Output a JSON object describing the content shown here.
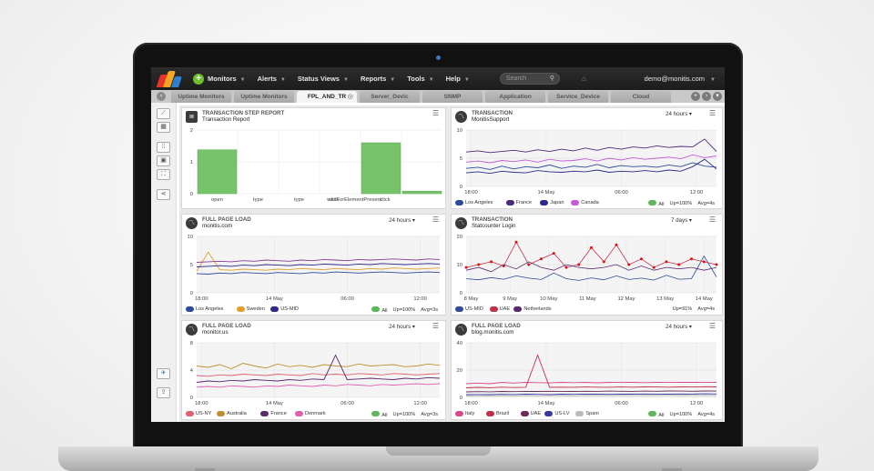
{
  "nav": {
    "menus": [
      {
        "label": "Monitors"
      },
      {
        "label": "Alerts"
      },
      {
        "label": "Status Views"
      },
      {
        "label": "Reports"
      },
      {
        "label": "Tools"
      },
      {
        "label": "Help"
      }
    ],
    "search_placeholder": "Search",
    "user": "demo@monitis.com"
  },
  "tabs": [
    {
      "label": "Uptime Monitors"
    },
    {
      "label": "Uptime Monitors"
    },
    {
      "label": "FPL_AND_TR"
    },
    {
      "label": "Server_Devic"
    },
    {
      "label": "SNMP"
    },
    {
      "label": "Application"
    },
    {
      "label": "Service_Device"
    },
    {
      "label": "Cloud"
    }
  ],
  "colors": {
    "accent": "#6fbf2e",
    "bar": "#77c36a"
  },
  "panels": [
    {
      "title": "TRANSACTION STEP REPORT",
      "subtitle": "Transaction Report",
      "icon": "document-icon",
      "chart_data": {
        "type": "bar",
        "categories": [
          "open",
          "type",
          "type",
          "click",
          "waitForElementPresent",
          "click"
        ],
        "values": [
          1.38,
          0,
          0,
          0,
          1.6,
          0.08
        ],
        "ylim": [
          0,
          2
        ],
        "yticks": [
          0,
          1,
          2
        ]
      }
    },
    {
      "title": "TRANSACTION",
      "subtitle": "MonitisSupport",
      "range": "24 hours",
      "icon": "trend-icon",
      "chart_data": {
        "type": "line",
        "xticks": [
          "18:00",
          "14 May",
          "06:00",
          "12:00"
        ],
        "ylim": [
          0,
          10
        ],
        "yticks": [
          0,
          5,
          10
        ],
        "series": [
          {
            "name": "Los Angeles",
            "color": "#2d4a9a",
            "values": [
              3.2,
              3.4,
              3,
              3.6,
              3.1,
              3.5,
              3.3,
              3.8,
              3.2,
              3.6,
              3.4,
              3.9,
              3.3,
              3.7,
              3.5,
              3.6,
              3.4,
              3.8,
              3.5,
              4.2,
              3.6,
              3.4
            ]
          },
          {
            "name": "France",
            "color": "#4a2a7a",
            "values": [
              6.1,
              6.3,
              6,
              6.2,
              6.4,
              6.1,
              6.5,
              6.2,
              6.6,
              6.3,
              6.8,
              6.4,
              6.9,
              6.6,
              7,
              6.8,
              7.2,
              6.9,
              7.1,
              7,
              8.4,
              6.2
            ]
          },
          {
            "name": "Japan",
            "color": "#2c2a8a",
            "values": [
              2.4,
              2.6,
              2.3,
              2.7,
              2.5,
              2.4,
              2.8,
              2.6,
              2.5,
              2.7,
              2.6,
              2.9,
              2.5,
              2.7,
              2.6,
              2.8,
              2.6,
              2.9,
              2.7,
              3.5,
              4.8,
              3.1
            ]
          },
          {
            "name": "Canada",
            "color": "#c25bd6",
            "values": [
              4.3,
              4.5,
              4.2,
              4.6,
              4.4,
              4.7,
              4.3,
              4.8,
              4.5,
              4.6,
              4.9,
              4.5,
              5,
              4.7,
              5.1,
              4.8,
              5,
              5.2,
              4.9,
              5.6,
              5.1,
              5.4
            ]
          }
        ]
      },
      "footer": {
        "all": "All",
        "up": "Up=100%",
        "avg": "Avg=4s"
      }
    },
    {
      "title": "FULL PAGE LOAD",
      "subtitle": "monitis.com",
      "range": "24 hours",
      "icon": "trend-icon",
      "chart_data": {
        "type": "line",
        "xticks": [
          "18:00",
          "14 May",
          "06:00",
          "12:00"
        ],
        "ylim": [
          0,
          10
        ],
        "yticks": [
          0,
          5,
          10
        ],
        "series": [
          {
            "name": "Los Angeles",
            "color": "#2d4a9a",
            "values": [
              3.4,
              3.3,
              3.5,
              3.4,
              3.6,
              3.5,
              3.4,
              3.6,
              3.5,
              3.4,
              3.6,
              3.5,
              3.7,
              3.6,
              3.5,
              3.6,
              3.7,
              3.6,
              3.5,
              3.6,
              3.7,
              3.6
            ]
          },
          {
            "name": "Sweden",
            "color": "#e0a030",
            "values": [
              3.8,
              7.2,
              4.1,
              4,
              4.2,
              4.1,
              4,
              4.2,
              4.1,
              4.3,
              4.2,
              4.1,
              4.3,
              4.2,
              4.1,
              4.3,
              4.2,
              4.4,
              4.3,
              4.2,
              4.3,
              4.4
            ]
          },
          {
            "name": "US-MID",
            "color": "#2c2a8a",
            "values": [
              4.6,
              4.7,
              4.8,
              4.7,
              4.9,
              4.8,
              5,
              4.9,
              4.8,
              5,
              4.9,
              5.1,
              5,
              4.9,
              5.1,
              5,
              5.2,
              5.1,
              5,
              5.1,
              5.2,
              5.1
            ]
          },
          {
            "name": "",
            "color": "#8a3a9a",
            "values": [
              5.4,
              5.5,
              5.6,
              5.5,
              5.7,
              5.6,
              5.8,
              5.7,
              5.6,
              5.8,
              5.7,
              5.9,
              5.8,
              5.7,
              5.9,
              5.8,
              5.9,
              6,
              5.9,
              5.8,
              6,
              5.9
            ]
          }
        ]
      },
      "footer": {
        "all": "All",
        "up": "Up=100%",
        "avg": "Avg=3s"
      }
    },
    {
      "title": "TRANSACTION",
      "subtitle": "Statcounter Login",
      "range": "7 days",
      "icon": "trend-icon",
      "chart_data": {
        "type": "line",
        "xticks": [
          "8 May",
          "9 May",
          "10 May",
          "11 May",
          "12 May",
          "13 May",
          "14 May"
        ],
        "ylim": [
          0,
          20
        ],
        "yticks": [
          0,
          10,
          20
        ],
        "series": [
          {
            "name": "US-MID",
            "color": "#2d4a9a",
            "values": [
              5,
              4.6,
              5.4,
              4.8,
              6,
              5.2,
              4.7,
              7,
              5,
              4.4,
              5.3,
              4.6,
              6,
              4.7,
              5.2,
              4.5,
              6.2,
              4.8,
              5,
              13,
              5.6
            ]
          },
          {
            "name": "UAE",
            "color": "#c0304a",
            "values": [
              9,
              10,
              11,
              9.5,
              18,
              10,
              12,
              14,
              9,
              10,
              16,
              11,
              17,
              10,
              12,
              9,
              11,
              10,
              12,
              11,
              10
            ]
          },
          {
            "name": "Netherlands",
            "color": "#5a2a6a",
            "values": [
              8,
              9,
              7.5,
              10,
              8.5,
              11,
              9,
              8,
              10,
              9,
              8.5,
              9,
              10,
              8,
              9.5,
              8,
              9,
              8.5,
              9,
              8,
              9
            ]
          }
        ]
      },
      "footer": {
        "up": "Up=91%",
        "avg": "Avg=4s"
      }
    },
    {
      "title": "FULL PAGE LOAD",
      "subtitle": "monitor.us",
      "range": "24 hours",
      "icon": "trend-icon",
      "chart_data": {
        "type": "line",
        "xticks": [
          "18:00",
          "14 May",
          "06:00",
          "12:00"
        ],
        "ylim": [
          0,
          8
        ],
        "yticks": [
          0,
          4,
          8
        ],
        "series": [
          {
            "name": "US-NY",
            "color": "#e06070",
            "values": [
              3.2,
              3.1,
              3.3,
              3.2,
              3.4,
              3.3,
              3.2,
              3.4,
              3.3,
              3.2,
              3.5,
              3.3,
              3.4,
              3.3,
              3.5,
              3.4,
              3.3,
              3.5,
              3.4,
              3.3,
              3.4,
              3.5
            ]
          },
          {
            "name": "Australia",
            "color": "#c09030",
            "values": [
              4.6,
              4.4,
              4.8,
              4.2,
              5,
              4.6,
              4.3,
              4.9,
              4.5,
              4.7,
              4.4,
              4.8,
              4.6,
              4.5,
              4.9,
              4.6,
              4.7,
              4.8,
              4.5,
              4.6,
              4.9,
              4.7
            ]
          },
          {
            "name": "France",
            "color": "#5a2a6a",
            "values": [
              2.2,
              2.4,
              2.3,
              2.5,
              2.4,
              2.6,
              2.5,
              2.4,
              2.6,
              2.5,
              2.7,
              2.6,
              6.2,
              2.6,
              2.7,
              2.8,
              2.7,
              2.6,
              2.8,
              2.7,
              2.9,
              2.8
            ]
          },
          {
            "name": "Denmark",
            "color": "#e060b0",
            "values": [
              1.5,
              1.6,
              1.5,
              1.7,
              1.6,
              1.5,
              1.7,
              1.6,
              1.8,
              1.7,
              1.6,
              1.8,
              1.7,
              1.9,
              1.8,
              1.7,
              1.9,
              1.8,
              1.9,
              2,
              1.9,
              2
            ]
          }
        ]
      },
      "footer": {
        "all": "All",
        "up": "Up=100%",
        "avg": "Avg=3s"
      }
    },
    {
      "title": "FULL PAGE LOAD",
      "subtitle": "blog.monitis.com",
      "range": "24 hours",
      "icon": "trend-icon",
      "chart_data": {
        "type": "line",
        "xticks": [
          "18:00",
          "14 May",
          "06:00",
          "12:00"
        ],
        "ylim": [
          0,
          40
        ],
        "yticks": [
          0,
          20,
          40
        ],
        "series": [
          {
            "name": "Italy",
            "color": "#d84a8a",
            "values": [
              10,
              10.5,
              10,
              11,
              10.5,
              11,
              10.8,
              10.6,
              11,
              10.8,
              11,
              10.7,
              11,
              10.9,
              11,
              10.8,
              11,
              10.9,
              11,
              11,
              10.9,
              11
            ]
          },
          {
            "name": "Brazil",
            "color": "#c0304a",
            "values": [
              7,
              7.3,
              7.1,
              7.5,
              7.2,
              7.4,
              31,
              7.3,
              7.5,
              7.4,
              7.6,
              7.5,
              7.4,
              7.6,
              7.5,
              7.7,
              7.6,
              7.5,
              7.7,
              7.6,
              7.8,
              7.7
            ]
          },
          {
            "name": "UAE",
            "color": "#6a2a5a",
            "values": [
              4,
              4.2,
              4.1,
              4.3,
              4.2,
              4.4,
              4.3,
              4.5,
              4.4,
              4.3,
              4.5,
              4.4,
              4.6,
              4.5,
              4.4,
              4.6,
              4.5,
              4.7,
              4.6,
              4.5,
              4.7,
              4.6
            ]
          },
          {
            "name": "US-LV",
            "color": "#3a3a9a",
            "values": [
              2,
              2.1,
              2,
              2.2,
              2.1,
              2.3,
              2.2,
              2.1,
              2.3,
              2.2,
              2.4,
              2.3,
              2.2,
              2.4,
              2.3,
              2.5,
              2.4,
              2.3,
              2.5,
              2.4,
              2.6,
              2.5
            ]
          },
          {
            "name": "Spain",
            "color": "#bbbbbb",
            "values": [
              1,
              1.1,
              1,
              1.2,
              1.1,
              1.2,
              1.1,
              1.3,
              1.2,
              1.1,
              1.3,
              1.2,
              1.4,
              1.3,
              1.2,
              1.4,
              1.3,
              1.4,
              1.3,
              1.4,
              1.3,
              1.4
            ]
          }
        ]
      },
      "footer": {
        "all": "All",
        "up": "Up=100%",
        "avg": "Avg=4s"
      }
    }
  ]
}
